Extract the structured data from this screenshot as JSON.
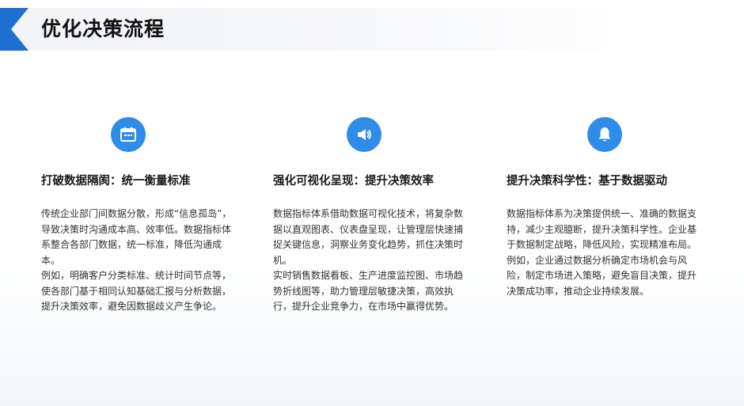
{
  "header": {
    "title": "优化决策流程"
  },
  "columns": [
    {
      "icon": "calendar-icon",
      "heading": "打破数据隔阂：统一衡量标准",
      "paragraphs": [
        "传统企业部门间数据分散，形成“信息孤岛”，导致决策时沟通成本高、效率低。数据指标体系整合各部门数据，统一标准，降低沟通成本。",
        "例如，明确客户分类标准、统计时间节点等，使各部门基于相同认知基础汇报与分析数据，提升决策效率，避免因数据歧义产生争论。"
      ]
    },
    {
      "icon": "megaphone-icon",
      "heading": "强化可视化呈现：提升决策效率",
      "paragraphs": [
        "数据指标体系借助数据可视化技术，将复杂数据以直观图表、仪表盘呈现，让管理层快速捕捉关键信息，洞察业务变化趋势，抓住决策时机。",
        "实时销售数据看板、生产进度监控图、市场趋势折线图等，助力管理层敏捷决策，高效执行，提升企业竞争力，在市场中赢得优势。"
      ]
    },
    {
      "icon": "bell-icon",
      "heading": "提升决策科学性：基于数据驱动",
      "paragraphs": [
        "数据指标体系为决策提供统一、准确的数据支持，减少主观臆断，提升决策科学性。企业基于数据制定战略，降低风险，实现精准布局。",
        "例如，企业通过数据分析确定市场机会与风险，制定市场进入策略，避免盲目决策，提升决策成功率，推动企业持续发展。"
      ]
    }
  ],
  "colors": {
    "accent": "#2f8ce8",
    "accent_dark": "#1f6fd1"
  }
}
